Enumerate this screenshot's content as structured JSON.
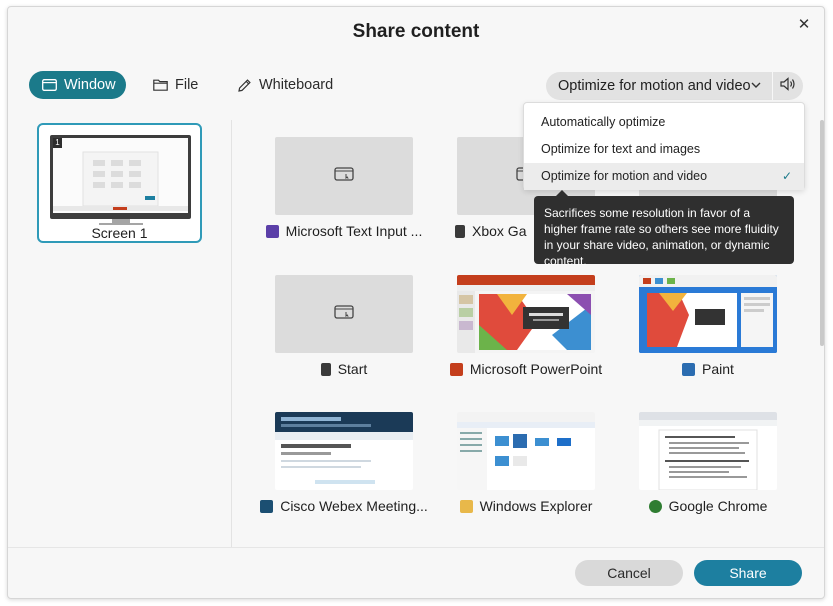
{
  "dialog": {
    "title": "Share content",
    "close_label": "✕"
  },
  "tabs": [
    {
      "label": "Window",
      "icon": "window-icon",
      "active": true
    },
    {
      "label": "File",
      "icon": "folder-icon",
      "active": false
    },
    {
      "label": "Whiteboard",
      "icon": "pencil-icon",
      "active": false
    }
  ],
  "optimize": {
    "selected": "Optimize for motion and video",
    "options": [
      {
        "label": "Automatically optimize",
        "selected": false
      },
      {
        "label": "Optimize for text and images",
        "selected": false
      },
      {
        "label": "Optimize for motion and video",
        "selected": true
      }
    ],
    "check": "✓",
    "tooltip": "Sacrifices some resolution in favor of a higher frame rate so others see more fluidity in your share video, animation, or dynamic content."
  },
  "screens": [
    {
      "label": "Screen 1",
      "number": "1"
    }
  ],
  "windows": [
    {
      "label": "Microsoft Text Input ...",
      "icon": "text-input-app-icon",
      "icon_color": "#5b3fa8",
      "thumbnail": "placeholder"
    },
    {
      "label": "Xbox Ga",
      "icon": "xbox-app-icon",
      "icon_color": "#3a3a3a",
      "thumbnail": "placeholder"
    },
    {
      "label": "",
      "icon": "",
      "icon_color": "",
      "thumbnail": "placeholder"
    },
    {
      "label": "Start",
      "icon": "start-app-icon",
      "icon_color": "#3a3a3a",
      "thumbnail": "placeholder"
    },
    {
      "label": "Microsoft PowerPoint",
      "icon": "powerpoint-app-icon",
      "icon_color": "#c43e1c",
      "thumbnail": "powerpoint"
    },
    {
      "label": "Paint",
      "icon": "paint-app-icon",
      "icon_color": "#2b6cb0",
      "thumbnail": "paint"
    },
    {
      "label": "Cisco Webex Meeting...",
      "icon": "webex-app-icon",
      "icon_color": "#1b4f72",
      "thumbnail": "webex"
    },
    {
      "label": "Windows Explorer",
      "icon": "explorer-app-icon",
      "icon_color": "#e8b84a",
      "thumbnail": "explorer"
    },
    {
      "label": "Google Chrome",
      "icon": "chrome-app-icon",
      "icon_color": "#2f7d32",
      "thumbnail": "chrome"
    }
  ],
  "footer": {
    "cancel_label": "Cancel",
    "share_label": "Share"
  },
  "colors": {
    "accent": "#1b7a8a",
    "share_button": "#1d7fa0",
    "tooltip_bg": "#2f2f2f"
  }
}
